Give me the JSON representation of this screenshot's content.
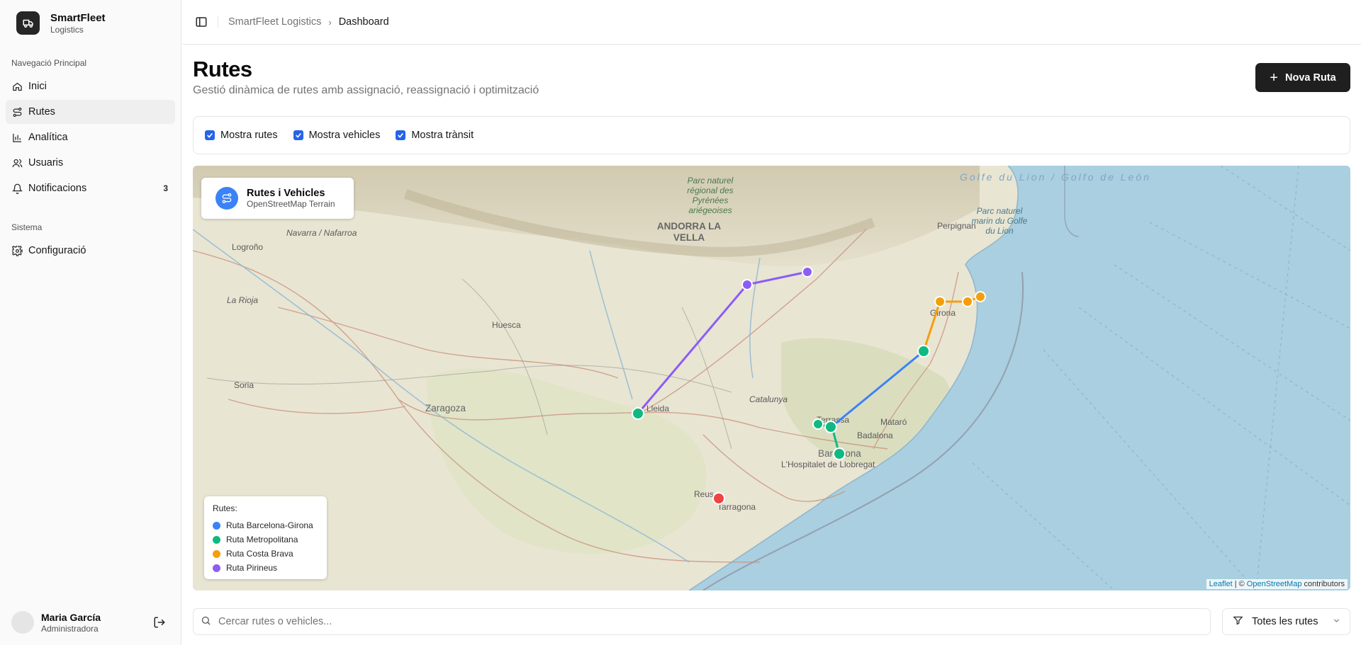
{
  "brand": {
    "name": "SmartFleet",
    "sub": "Logistics"
  },
  "sidebar": {
    "main_label": "Navegació Principal",
    "items": [
      {
        "label": "Inici",
        "icon": "home-icon"
      },
      {
        "label": "Rutes",
        "icon": "route-icon",
        "active": true
      },
      {
        "label": "Analítica",
        "icon": "chart-icon"
      },
      {
        "label": "Usuaris",
        "icon": "users-icon"
      },
      {
        "label": "Notificacions",
        "icon": "bell-icon",
        "badge": "3"
      }
    ],
    "system_label": "Sistema",
    "system_items": [
      {
        "label": "Configuració",
        "icon": "gear-icon"
      }
    ]
  },
  "user": {
    "name": "Maria García",
    "role": "Administradora"
  },
  "breadcrumb": {
    "root": "SmartFleet Logistics",
    "current": "Dashboard"
  },
  "page": {
    "title": "Rutes",
    "subtitle": "Gestió dinàmica de rutes amb assignació, reassignació i optimització",
    "new_button": "Nova Ruta"
  },
  "filters": {
    "show_routes": "Mostra rutes",
    "show_vehicles": "Mostra vehicles",
    "show_traffic": "Mostra trànsit"
  },
  "map": {
    "card_title": "Rutes i Vehicles",
    "card_sub": "OpenStreetMap Terrain",
    "legend_title": "Rutes:",
    "legend": [
      {
        "name": "Ruta Barcelona-Girona",
        "color": "#3b82f6"
      },
      {
        "name": "Ruta Metropolitana",
        "color": "#10b981"
      },
      {
        "name": "Ruta Costa Brava",
        "color": "#f59e0b"
      },
      {
        "name": "Ruta Pirineus",
        "color": "#8b5cf6"
      }
    ],
    "attrib_leaflet": "Leaflet",
    "attrib_sep": "| ©",
    "attrib_osm": "OpenStreetMap",
    "attrib_tail": "contributors",
    "labels": {
      "zaragoza": "Zaragoza",
      "huesca": "Huesca",
      "lleida": "Lleida",
      "andorra": "ANDORRA LA VELLA",
      "girona": "Girona",
      "barcelona": "Barcelona",
      "hospitalet": "L'Hospitalet de Llobregat",
      "badalona": "Badalona",
      "mataro": "Mataró",
      "terrassa": "Terrassa",
      "tarragona": "Tarragona",
      "reus": "Reus",
      "perpignan": "Perpignan",
      "logrono": "Logroño",
      "soria": "Soria",
      "navarra": "Navarra / Nafarroa",
      "larioja": "La Rioja",
      "catalunya": "Catalunya",
      "gulf": "Golfe du Lion / Golfo de León",
      "parc1": "Parc naturel régional des Pyrénées ariégeoises",
      "parc2": "Parc naturel marin du Golfe du Lion"
    }
  },
  "search": {
    "placeholder": "Cercar rutes o vehicles..."
  },
  "route_filter": {
    "label": "Totes les rutes"
  },
  "colors": {
    "accent": "#2563eb",
    "primary_btn": "#1f1f1f",
    "sea": "#a9cfe0",
    "land": "#e8e4d4"
  }
}
